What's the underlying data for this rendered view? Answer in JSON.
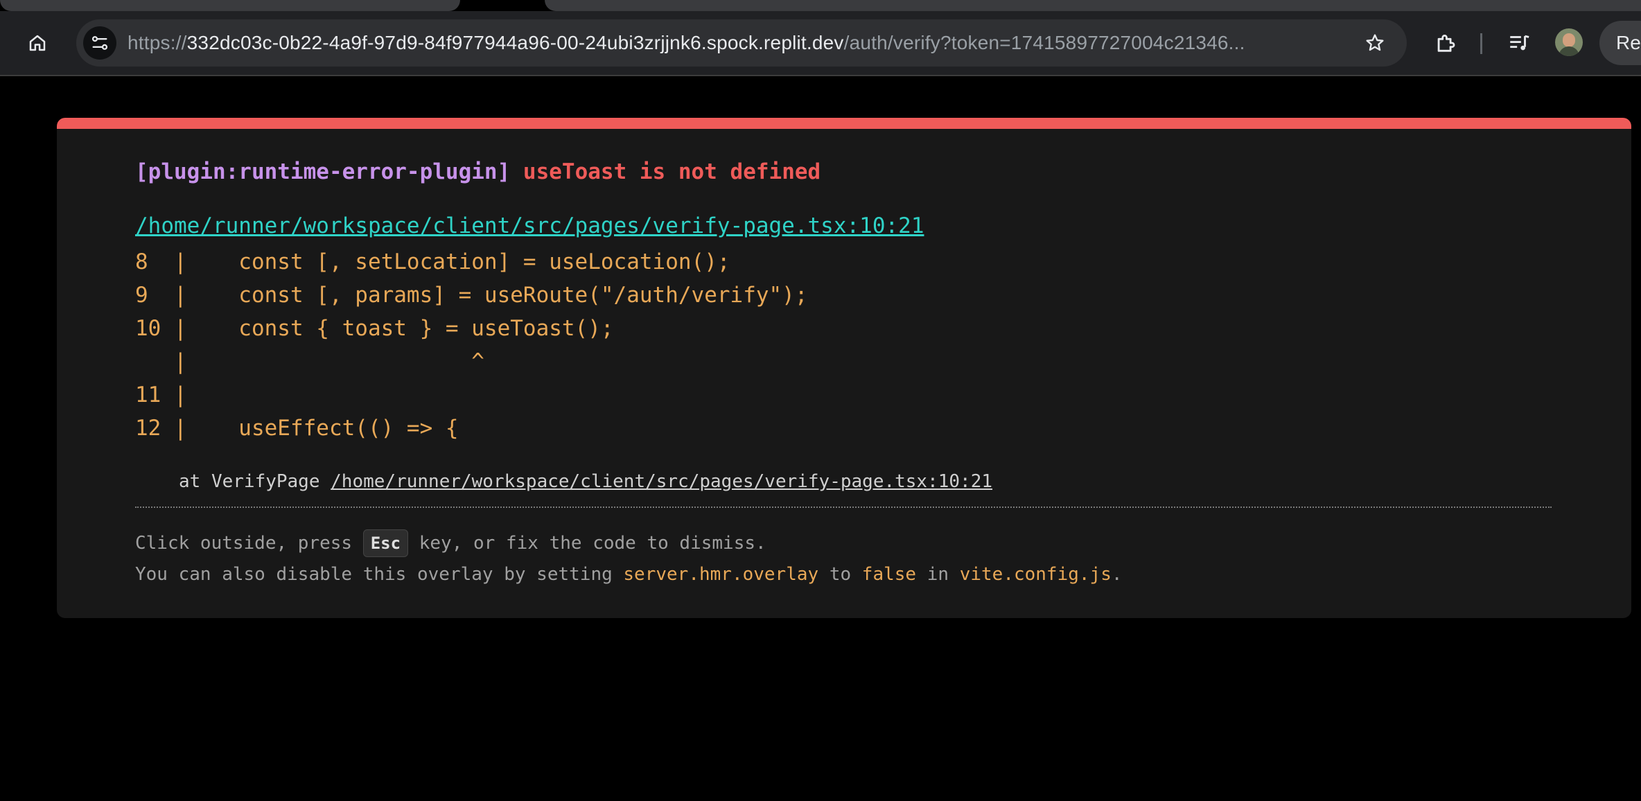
{
  "browser": {
    "url_scheme": "https://",
    "url_host": "332dc03c-0b22-4a9f-97d9-84f977944a96-00-24ubi3zrjjnk6.spock.replit.dev",
    "url_path": "/auth/verify?token=17415897727004c21346...",
    "relaunch_label": "Rel",
    "icons": [
      "home-icon",
      "site-info-icon",
      "bookmark-star-icon",
      "extensions-icon",
      "media-queue-icon",
      "profile-avatar"
    ],
    "colors": {
      "toolbar": "#202124",
      "omnibox": "#2f3033"
    }
  },
  "overlay": {
    "plugin": "[plugin:runtime-error-plugin]",
    "message": "useToast is not defined",
    "file": "/home/runner/workspace/client/src/pages/verify-page.tsx:10:21",
    "frame_lines": [
      "8  |    const [, setLocation] = useLocation();",
      "9  |    const [, params] = useRoute(\"/auth/verify\");",
      "10 |    const { toast } = useToast();",
      "   |                      ^",
      "11 |",
      "12 |    useEffect(() => {"
    ],
    "stack_prefix": "at VerifyPage ",
    "stack_link": "/home/runner/workspace/client/src/pages/verify-page.tsx:10:21",
    "tip1_a": "Click outside, press ",
    "tip1_key": "Esc",
    "tip1_b": " key, or fix the code to dismiss.",
    "tip2_a": "You can also disable this overlay by setting ",
    "tip2_code1": "server.hmr.overlay",
    "tip2_b": " to ",
    "tip2_code2": "false",
    "tip2_c": " in ",
    "tip2_code3": "vite.config.js",
    "tip2_d": ".",
    "colors": {
      "accent": "#ef5b59",
      "plugin": "#c792ea",
      "link": "#2fd3c7",
      "code": "#e8a857",
      "background": "#181818"
    }
  }
}
